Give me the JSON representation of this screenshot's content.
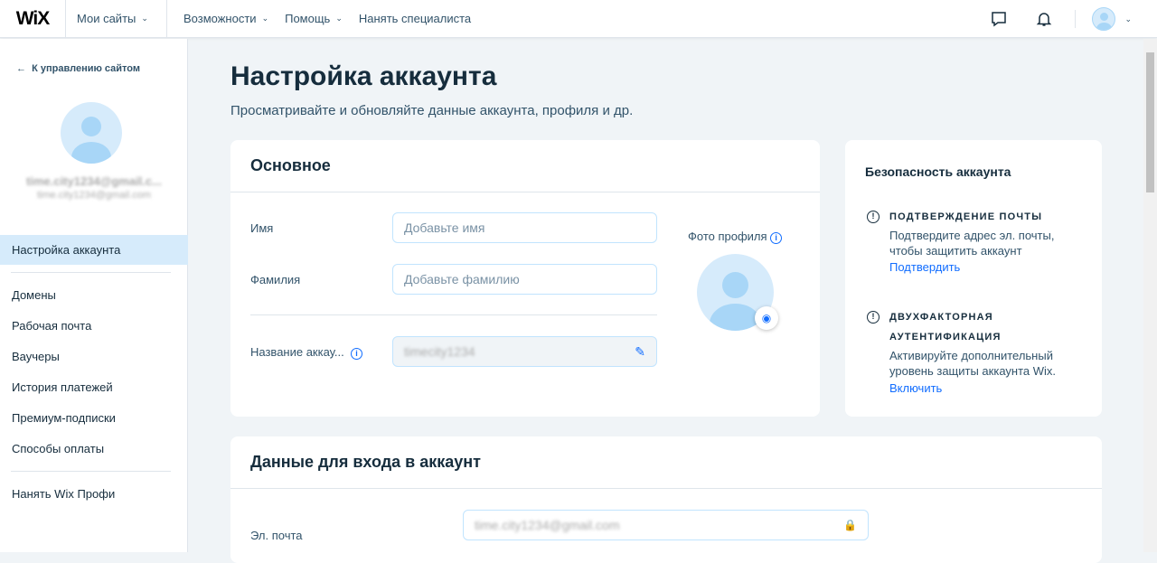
{
  "topbar": {
    "logo": "WiX",
    "my_sites": "Мои сайты",
    "nav": [
      "Возможности",
      "Помощь",
      "Нанять специалиста"
    ]
  },
  "sidebar": {
    "back": "К управлению сайтом",
    "email_main": "time.city1234@gmail.c...",
    "email_sub": "time.city1234@gmail.com",
    "items": [
      "Настройка аккаунта",
      "Домены",
      "Рабочая почта",
      "Ваучеры",
      "История платежей",
      "Премиум-подписки",
      "Способы оплаты",
      "Нанять Wix Профи"
    ]
  },
  "page": {
    "title": "Настройка аккаунта",
    "subtitle": "Просматривайте и обновляйте данные аккаунта, профиля и др."
  },
  "basic": {
    "title": "Основное",
    "first_name_label": "Имя",
    "first_name_placeholder": "Добавьте имя",
    "last_name_label": "Фамилия",
    "last_name_placeholder": "Добавьте фамилию",
    "account_name_label": "Название аккау...",
    "account_name_value": "timecity1234",
    "photo_label": "Фото профиля"
  },
  "security": {
    "title": "Безопасность аккаунта",
    "email_verify_title": "ПОДТВЕРЖДЕНИЕ ПОЧТЫ",
    "email_verify_text": "Подтвердите адрес эл. почты, чтобы защитить аккаунт",
    "email_verify_link": "Подтвердить",
    "twofa_title_1": "ДВУХФАКТОРНАЯ",
    "twofa_title_2": "АУТЕНТИФИКАЦИЯ",
    "twofa_text": "Активируйте дополнительный уровень защиты аккаунта Wix.",
    "twofa_link": "Включить"
  },
  "login": {
    "title": "Данные для входа в аккаунт",
    "email_label": "Эл. почта",
    "email_value": "time.city1234@gmail.com"
  }
}
